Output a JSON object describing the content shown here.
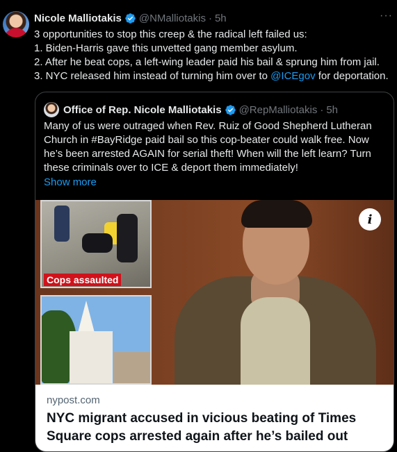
{
  "author": {
    "name": "Nicole Malliotakis",
    "handle": "@NMalliotakis",
    "separator": "·",
    "time": "5h"
  },
  "tweet": {
    "text_before_mention": "3 opportunities to stop this creep & the radical left failed us:\n1. Biden-Harris gave this unvetted gang member asylum.\n2. After he beat cops, a left-wing leader paid his bail & sprung him from jail.\n3. NYC released him instead of turning him over to ",
    "mention": "@ICEgov",
    "text_after_mention": " for deportation."
  },
  "more_menu_icon": "ellipsis-icon",
  "quote": {
    "name": "Office of Rep. Nicole Malliotakis",
    "handle": "@RepMalliotakis",
    "separator": "·",
    "time": "5h",
    "text": "Many of us were outraged when Rev. Ruiz of Good Shepherd Lutheran Church in #BayRidge paid bail so this cop-beater could walk free. Now he’s been arrested AGAIN for serial theft! When will the left learn? Turn these criminals over to ICE & deport them immediately!",
    "show_more": "Show more"
  },
  "card": {
    "image_caption": "Cops assaulted",
    "info_icon": "info-icon",
    "domain": "nypost.com",
    "headline": "NYC migrant accused in vicious beating of Times Square cops arrested again after he’s bailed out"
  },
  "colors": {
    "background": "#000000",
    "link": "#1d9bf0",
    "muted": "#71767b",
    "verified": "#1d9bf0",
    "caption_red": "#d0121b"
  }
}
